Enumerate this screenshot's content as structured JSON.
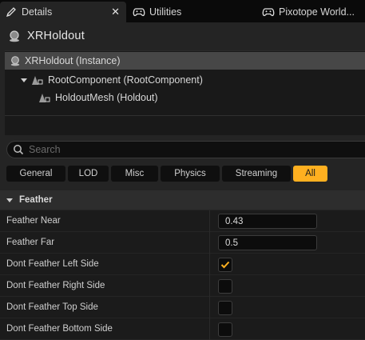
{
  "tabs": [
    {
      "label": "Details",
      "icon": "pencil-icon",
      "active": true,
      "close": "✕"
    },
    {
      "label": "Utilities",
      "icon": "gamepad-icon",
      "active": false
    },
    {
      "label": "Pixotope World...",
      "icon": "gamepad-icon",
      "active": false
    }
  ],
  "actor": {
    "title": "XRHoldout"
  },
  "tree": {
    "items": [
      {
        "label": "XRHoldout (Instance)"
      },
      {
        "label": "RootComponent (RootComponent)"
      },
      {
        "label": "HoldoutMesh (Holdout)"
      }
    ]
  },
  "search": {
    "placeholder": "Search",
    "value": ""
  },
  "filters": [
    {
      "label": "General"
    },
    {
      "label": "LOD"
    },
    {
      "label": "Misc"
    },
    {
      "label": "Physics"
    },
    {
      "label": "Streaming"
    },
    {
      "label": "All",
      "active": true
    }
  ],
  "category": {
    "title": "Feather"
  },
  "properties": [
    {
      "label": "Feather Near",
      "value": "0.43"
    },
    {
      "label": "Feather Far",
      "value": "0.5"
    },
    {
      "label": "Dont Feather Left Side",
      "checked": true
    },
    {
      "label": "Dont Feather Right Side",
      "checked": false
    },
    {
      "label": "Dont Feather Top Side",
      "checked": false
    },
    {
      "label": "Dont Feather Bottom Side",
      "checked": false
    }
  ],
  "colors": {
    "accent": "#ffb020",
    "panel": "#242424",
    "selection": "#474747"
  }
}
